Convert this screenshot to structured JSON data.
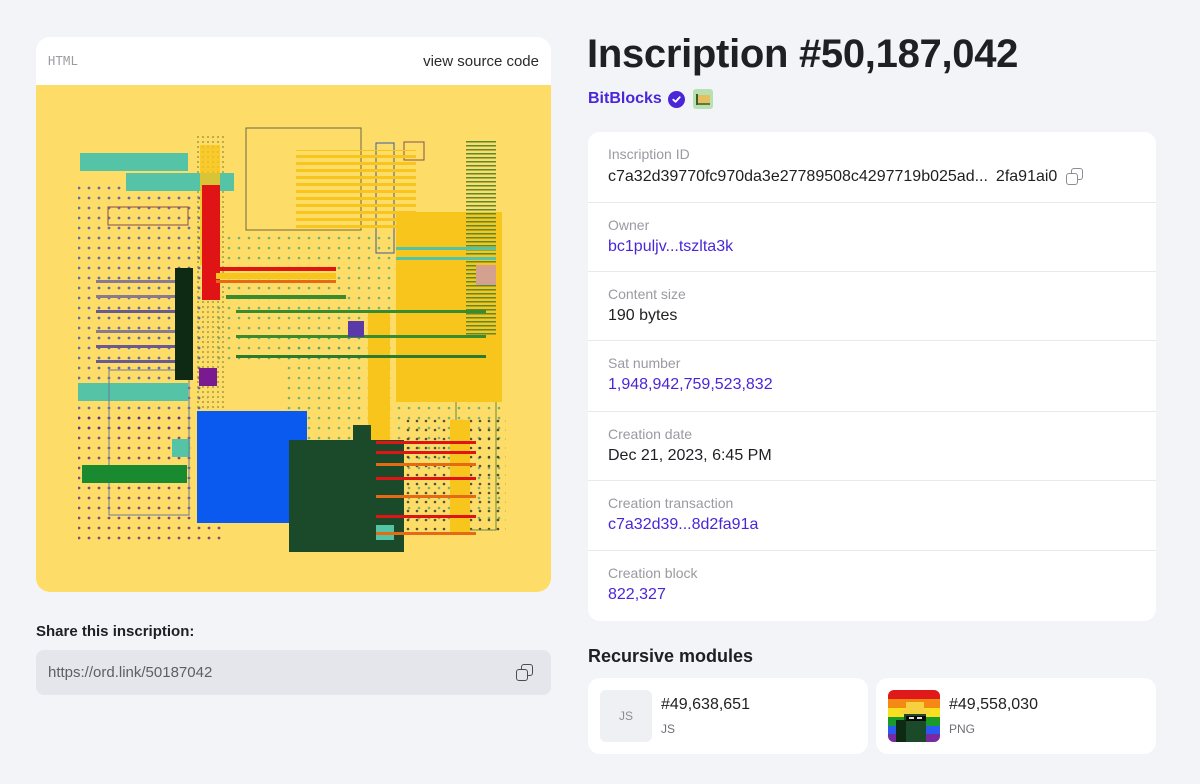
{
  "preview": {
    "content_type": "HTML",
    "view_source_label": "view source code"
  },
  "share": {
    "label": "Share this inscription:",
    "url": "https://ord.link/50187042"
  },
  "header": {
    "title": "Inscription #50,187,042",
    "collection_name": "BitBlocks",
    "verified": true
  },
  "details": {
    "inscription_id": {
      "label": "Inscription ID",
      "value_head": "c7a32d39770fc970da3e27789508c4297719b025ad...",
      "value_tail": "2fa91ai0"
    },
    "owner": {
      "label": "Owner",
      "value": "bc1puljv...tszlta3k"
    },
    "content_size": {
      "label": "Content size",
      "value": "190 bytes"
    },
    "sat_number": {
      "label": "Sat number",
      "value": "1,948,942,759,523,832"
    },
    "creation_date": {
      "label": "Creation date",
      "value": "Dec 21, 2023, 6:45 PM"
    },
    "creation_transaction": {
      "label": "Creation transaction",
      "value": "c7a32d39...8d2fa91a"
    },
    "creation_block": {
      "label": "Creation block",
      "value": "822,327"
    }
  },
  "recursive": {
    "title": "Recursive modules",
    "modules": [
      {
        "thumb_label": "JS",
        "number": "#49,638,651",
        "type": "JS"
      },
      {
        "thumb_label": "",
        "number": "#49,558,030",
        "type": "PNG"
      }
    ]
  },
  "colors": {
    "accent": "#4a26d8",
    "page_bg": "#f3f4f7",
    "art_bg": "#fddc68"
  }
}
